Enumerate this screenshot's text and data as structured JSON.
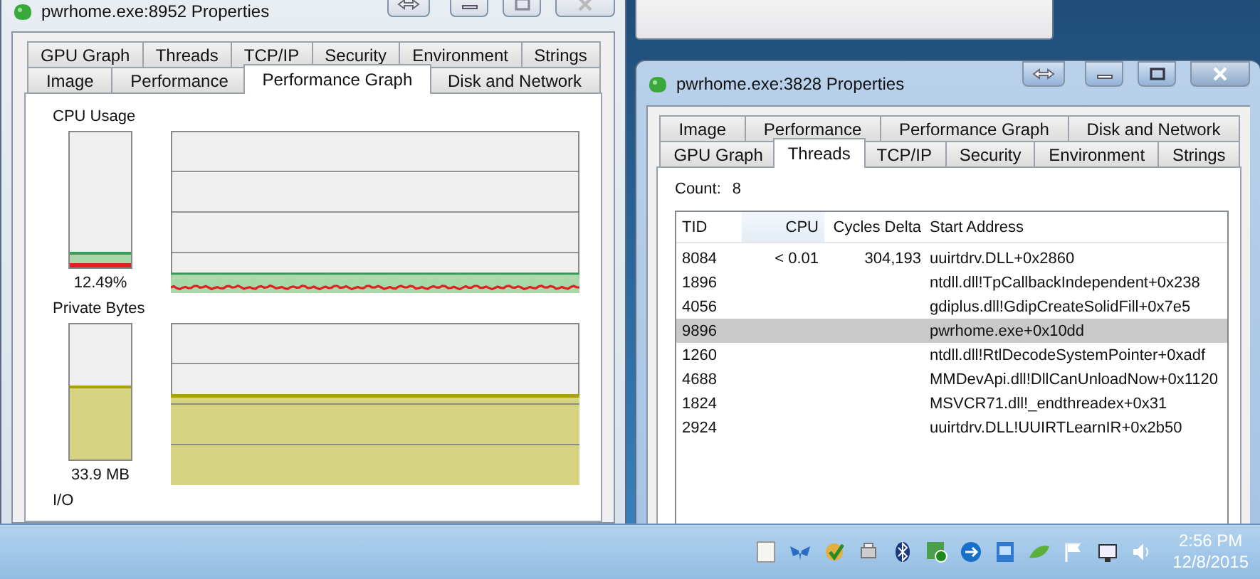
{
  "windows": [
    {
      "title": "pwrhome.exe:8952 Properties",
      "active": false,
      "tab_rows": [
        [
          {
            "label": "GPU Graph",
            "selected": false
          },
          {
            "label": "Threads",
            "selected": false
          },
          {
            "label": "TCP/IP",
            "selected": false
          },
          {
            "label": "Security",
            "selected": false
          },
          {
            "label": "Environment",
            "selected": false
          },
          {
            "label": "Strings",
            "selected": false
          }
        ],
        [
          {
            "label": "Image",
            "selected": false
          },
          {
            "label": "Performance",
            "selected": false
          },
          {
            "label": "Performance Graph",
            "selected": true
          },
          {
            "label": "Disk and Network",
            "selected": false
          }
        ]
      ],
      "panel": {
        "kind": "performance_graph",
        "meters": [
          {
            "kind": "cpu",
            "label": "CPU Usage",
            "level": 0.12,
            "reading": "12.49%"
          },
          {
            "kind": "memory",
            "label": "Private Bytes",
            "level": 0.55,
            "reading": "33.9 MB"
          }
        ],
        "next_section": "I/O"
      }
    },
    {
      "title": "pwrhome.exe:3828 Properties",
      "active": true,
      "tab_rows": [
        [
          {
            "label": "Image",
            "selected": false
          },
          {
            "label": "Performance",
            "selected": false
          },
          {
            "label": "Performance Graph",
            "selected": false
          },
          {
            "label": "Disk and Network",
            "selected": false
          }
        ],
        [
          {
            "label": "GPU Graph",
            "selected": false
          },
          {
            "label": "Threads",
            "selected": true
          },
          {
            "label": "TCP/IP",
            "selected": false
          },
          {
            "label": "Security",
            "selected": false
          },
          {
            "label": "Environment",
            "selected": false
          },
          {
            "label": "Strings",
            "selected": false
          }
        ]
      ],
      "panel": {
        "kind": "threads",
        "count_label": "Count:",
        "count": "8",
        "columns": [
          "TID",
          "CPU",
          "Cycles Delta",
          "Start Address"
        ],
        "rows": [
          {
            "cells": [
              "8084",
              "< 0.01",
              "304,193",
              "uuirtdrv.DLL+0x2860"
            ],
            "selected": false
          },
          {
            "cells": [
              "1896",
              "",
              "",
              "ntdll.dll!TpCallbackIndependent+0x238"
            ],
            "selected": false
          },
          {
            "cells": [
              "4056",
              "",
              "",
              "gdiplus.dll!GdipCreateSolidFill+0x7e5"
            ],
            "selected": false
          },
          {
            "cells": [
              "9896",
              "",
              "",
              "pwrhome.exe+0x10dd"
            ],
            "selected": true
          },
          {
            "cells": [
              "1260",
              "",
              "",
              "ntdll.dll!RtlDecodeSystemPointer+0xadf"
            ],
            "selected": false
          },
          {
            "cells": [
              "4688",
              "",
              "",
              "MMDevApi.dll!DllCanUnloadNow+0x1120"
            ],
            "selected": false
          },
          {
            "cells": [
              "1824",
              "",
              "",
              "MSVCR71.dll!_endthreadex+0x31"
            ],
            "selected": false
          },
          {
            "cells": [
              "2924",
              "",
              "",
              "uuirtdrv.DLL!UUIRTLearnIR+0x2b50"
            ],
            "selected": false
          }
        ]
      }
    }
  ],
  "taskbar": {
    "time": "2:56 PM",
    "date": "12/8/2015"
  }
}
